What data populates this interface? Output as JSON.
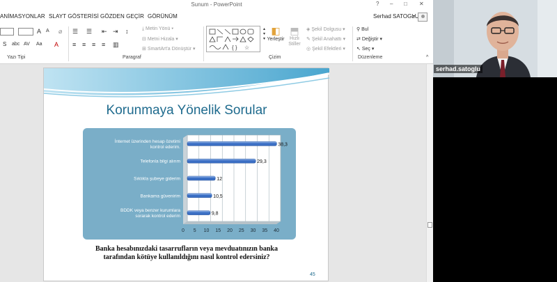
{
  "window": {
    "title": "Sunum - PowerPoint",
    "controls": [
      "?",
      "–",
      "□",
      "✕"
    ]
  },
  "tabs": [
    "ANİMASYONLAR",
    "SLAYT GÖSTERİSİ",
    "GÖZDEN GEÇİR",
    "GÖRÜNÜM"
  ],
  "user": "Serhad SATOGLU",
  "ribbon": {
    "groups": [
      "Yazı Tipi",
      "Paragraf",
      "Çizim",
      "Düzenleme"
    ],
    "font_buttons": [
      "S",
      "abc",
      "AV",
      "Aa"
    ],
    "paragraph": [
      "Metin Yönü",
      "Metni Hizala",
      "SmartArt'a Dönüştür"
    ],
    "drawing": [
      "Yerleştir",
      "Hızlı Stiller",
      "Şekil Dolgusu",
      "Şekil Anahattı",
      "Şekil Efektleri"
    ],
    "editing": [
      "Bul",
      "Değiştir",
      "Seç"
    ]
  },
  "slide": {
    "title": "Korunmaya Yönelik Sorular",
    "question_line1": "Banka hesabınızdaki tasarrufların veya mevduatınızın banka",
    "question_line2": "tarafından kötüye kullanıldığını nasıl kontrol edersiniz?",
    "page_number": "45"
  },
  "chart_data": {
    "type": "bar",
    "orientation": "horizontal",
    "categories": [
      "İnternet üzerinden hesap özetimi kontrol ederim.",
      "Telefonla bilgi alırım",
      "Sıklıkla şubeye giderim",
      "Bankama güvenirim",
      "BDDK veya benzer kurumlara sorarak kontrol ederim"
    ],
    "values": [
      38.3,
      29.3,
      12,
      10.5,
      9.8
    ],
    "value_labels": [
      "38,3",
      "29,3",
      "12",
      "10,5",
      "9,8"
    ],
    "xticks": [
      "0",
      "5",
      "10",
      "15",
      "20",
      "25",
      "30",
      "35",
      "40"
    ],
    "xlim": [
      0,
      40
    ],
    "grid": true,
    "colors": {
      "bar": "#3b6fc4",
      "panel": "#7aaec8"
    }
  },
  "webcam": {
    "name": "serhad.satoglu"
  }
}
